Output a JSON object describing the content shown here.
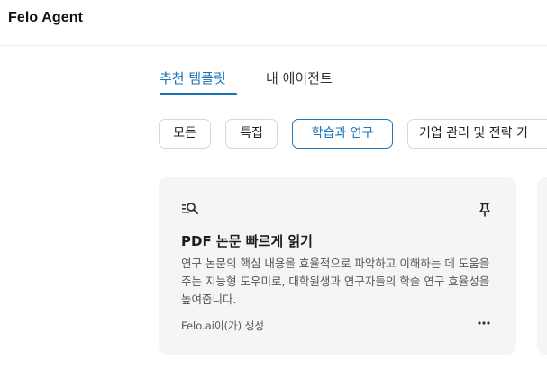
{
  "header": {
    "title": "Felo Agent"
  },
  "tabs": [
    {
      "label": "추천 템플릿",
      "active": true
    },
    {
      "label": "내 에이전트",
      "active": false
    }
  ],
  "categories": [
    {
      "label": "모든",
      "active": false
    },
    {
      "label": "특집",
      "active": false
    },
    {
      "label": "학습과 연구",
      "active": true
    },
    {
      "label": "기업 관리 및 전략 기",
      "active": false
    }
  ],
  "card": {
    "icon": "search-list-icon",
    "title": "PDF 논문 빠르게 읽기",
    "description": "연구 논문의 핵심 내용을 효율적으로 파악하고 이해하는 데 도움을 주는 지능형 도우미로, 대학원생과 연구자들의 학술 연구 효율성을 높여줍니다.",
    "footer": "Felo.ai이(가) 생성",
    "pin_icon": "pin-icon",
    "more_icon": "more-icon"
  },
  "colors": {
    "accent": "#1a73b8",
    "card_bg": "#f4f5f7"
  }
}
